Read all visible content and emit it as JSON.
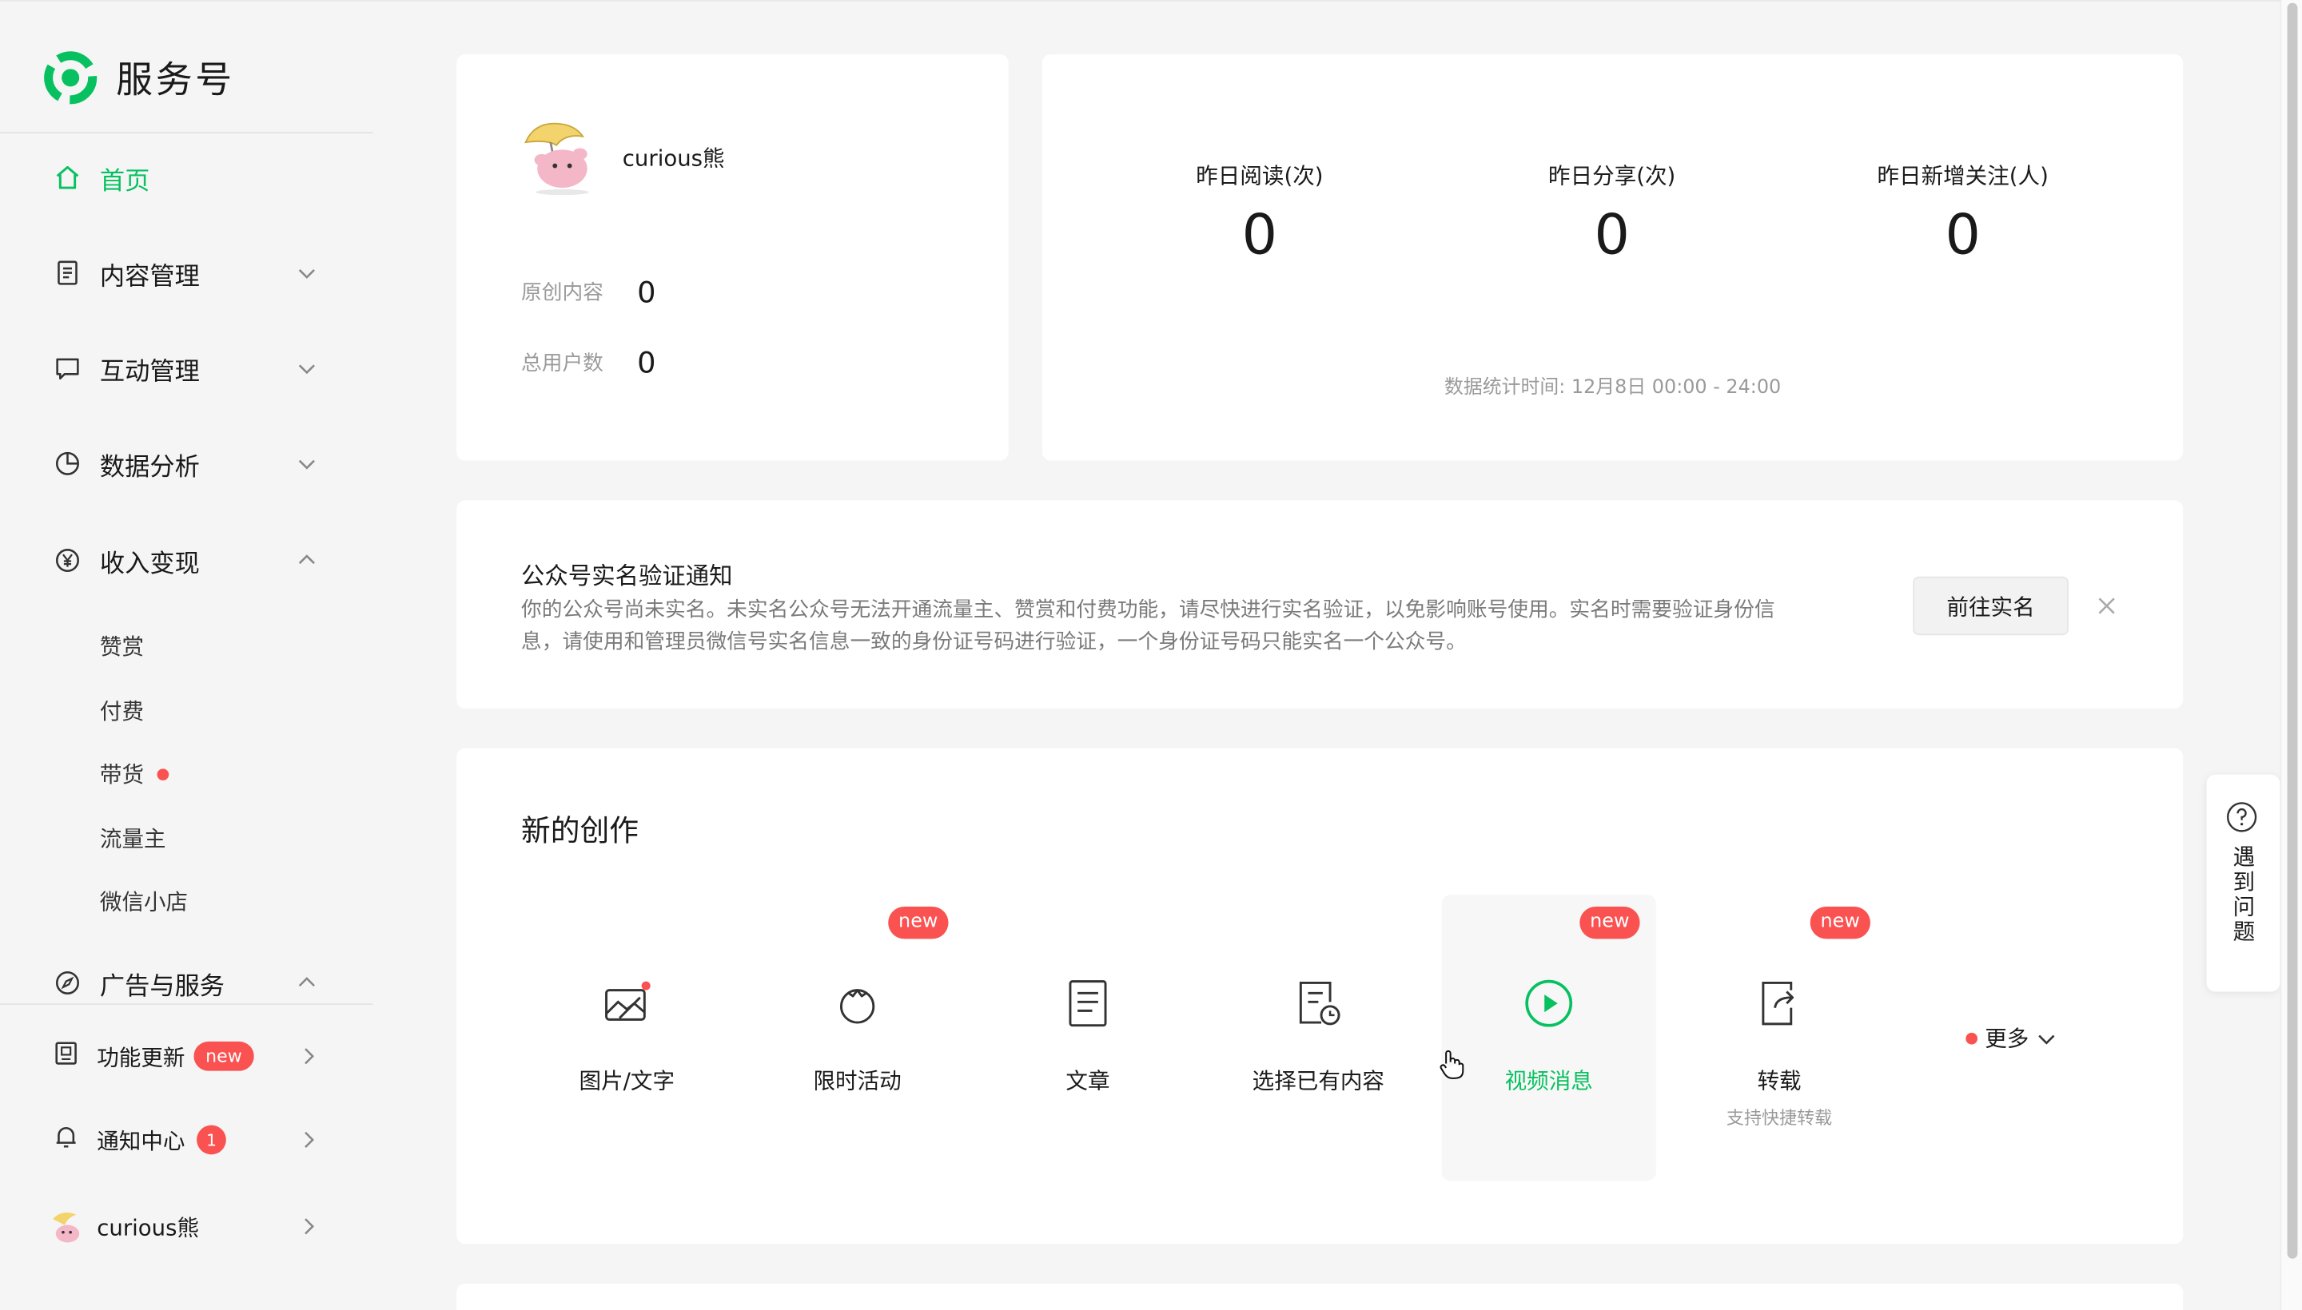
{
  "colors": {
    "brand": "#07c160",
    "alert": "#fa5151",
    "bg": "#f5f5f5",
    "card": "#ffffff"
  },
  "brand": {
    "name": "服务号",
    "logo_icon": "wechat-service-logo-icon"
  },
  "sidebar": {
    "items": [
      {
        "label": "首页",
        "icon": "home-icon",
        "active": true
      },
      {
        "label": "内容管理",
        "icon": "document-icon",
        "expanded": false
      },
      {
        "label": "互动管理",
        "icon": "chat-icon",
        "expanded": false
      },
      {
        "label": "数据分析",
        "icon": "pie-chart-icon",
        "expanded": false
      },
      {
        "label": "收入变现",
        "icon": "yen-icon",
        "expanded": true
      },
      {
        "label": "广告与服务",
        "icon": "compass-icon",
        "expanded": true
      }
    ],
    "income_sub": [
      {
        "label": "赞赏"
      },
      {
        "label": "付费"
      },
      {
        "label": "带货",
        "dot": true
      },
      {
        "label": "流量主"
      },
      {
        "label": "微信小店"
      }
    ],
    "footer": {
      "updates": {
        "label": "功能更新",
        "badge": "new"
      },
      "notices": {
        "label": "通知中心",
        "count": "1"
      },
      "account": {
        "label": "curious熊"
      }
    }
  },
  "profile": {
    "name": "curious熊",
    "original_label": "原创内容",
    "original_value": "0",
    "users_label": "总用户数",
    "users_value": "0"
  },
  "stats": {
    "reads_label": "昨日阅读(次)",
    "reads_value": "0",
    "shares_label": "昨日分享(次)",
    "shares_value": "0",
    "follows_label": "昨日新增关注(人)",
    "follows_value": "0",
    "time_note": "数据统计时间: 12月8日 00:00 - 24:00"
  },
  "notice": {
    "title": "公众号实名验证通知",
    "text": "你的公众号尚未实名。未实名公众号无法开通流量主、赞赏和付费功能，请尽快进行实名验证，以免影响账号使用。实名时需要验证身份信息，请使用和管理员微信号实名信息一致的身份证号码进行验证，一个身份证号码只能实名一个公众号。",
    "button": "前往实名"
  },
  "create": {
    "title": "新的创作",
    "new_badge": "new",
    "tiles": [
      {
        "label": "图片/文字",
        "icon": "image-text-icon"
      },
      {
        "label": "限时活动",
        "icon": "tomato-icon"
      },
      {
        "label": "文章",
        "icon": "article-icon"
      },
      {
        "label": "选择已有内容",
        "icon": "existing-content-icon"
      },
      {
        "label": "视频消息",
        "icon": "video-play-icon"
      },
      {
        "label": "转载",
        "icon": "repost-icon",
        "sub": "支持快捷转载"
      }
    ],
    "more": "更多"
  },
  "help": {
    "label": "遇到问题"
  }
}
